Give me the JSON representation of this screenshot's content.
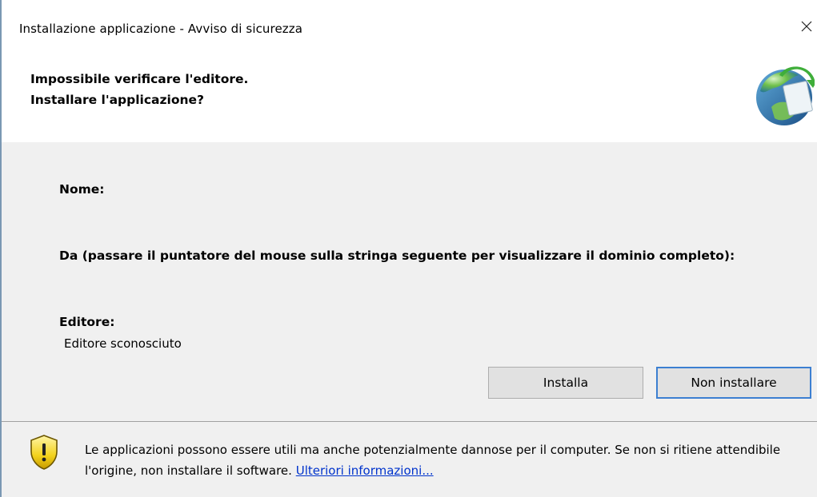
{
  "window": {
    "title": "Installazione applicazione - Avviso di sicurezza",
    "close_glyph": "×"
  },
  "header": {
    "line1": "Impossibile verificare l'editore.",
    "line2": "Installare l'applicazione?",
    "icon": "clickonce-globe-icon"
  },
  "details": {
    "name_label": "Nome:",
    "from_label": "Da (passare il puntatore del mouse sulla stringa seguente per visualizzare il dominio completo):",
    "publisher_label": "Editore:",
    "publisher_value": "Editore sconosciuto"
  },
  "buttons": {
    "install_label": "Installa",
    "dont_install_label": "Non installare"
  },
  "footer": {
    "warning_text": "Le applicazioni possono essere utili ma anche potenzialmente dannose per il computer. Se non si ritiene attendibile l'origine, non installare il software.",
    "link_text": "Ulteriori informazioni...",
    "icon": "warning-shield-icon"
  },
  "colors": {
    "accent_border": "#3c7fd1",
    "link": "#0033cc",
    "panel_background": "#f0f0f0"
  }
}
